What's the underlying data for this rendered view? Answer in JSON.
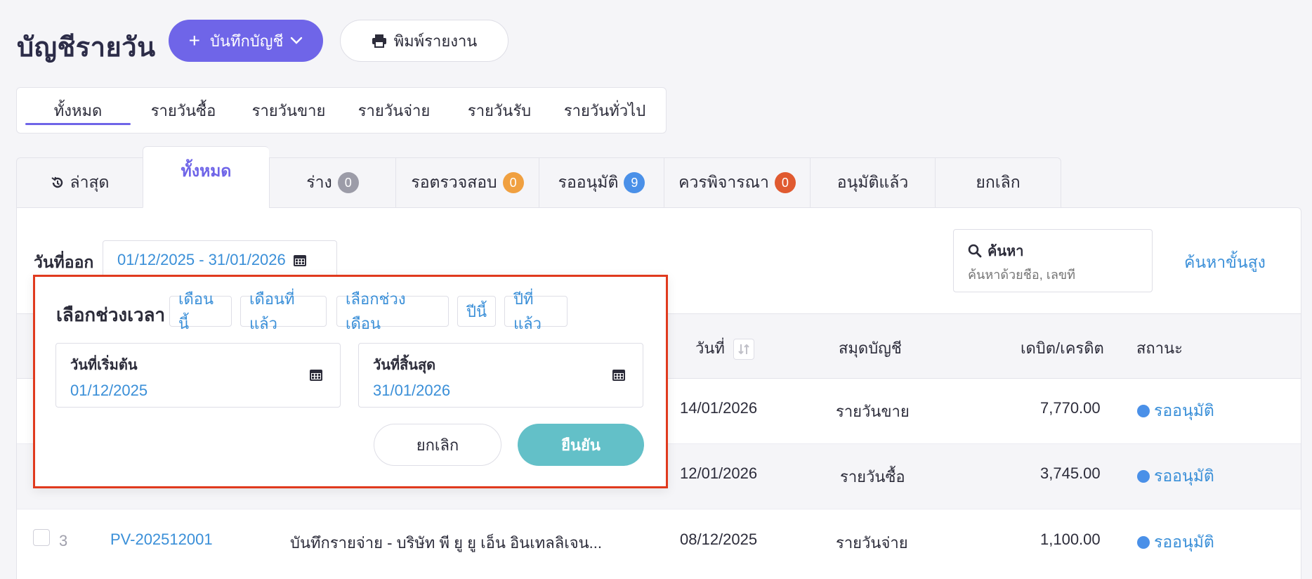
{
  "header": {
    "title": "บัญชีรายวัน",
    "record_button": "บันทึกบัญชี",
    "print_button": "พิมพ์รายงาน"
  },
  "type_tabs": [
    {
      "label": "ทั้งหมด",
      "active": true
    },
    {
      "label": "รายวันซื้อ"
    },
    {
      "label": "รายวันขาย"
    },
    {
      "label": "รายวันจ่าย"
    },
    {
      "label": "รายวันรับ"
    },
    {
      "label": "รายวันทั่วไป"
    }
  ],
  "status_tabs": [
    {
      "label": "ล่าสุด"
    },
    {
      "label": "ทั้งหมด",
      "active": true
    },
    {
      "label": "ร่าง",
      "count": "0",
      "color": "#9c9ca8"
    },
    {
      "label": "รอตรวจสอบ",
      "count": "0",
      "color": "#f0a040"
    },
    {
      "label": "รออนุมัติ",
      "count": "9",
      "color": "#4a90e8"
    },
    {
      "label": "ควรพิจารณา",
      "count": "0",
      "color": "#e05a30"
    },
    {
      "label": "อนุมัติแล้ว"
    },
    {
      "label": "ยกเลิก"
    }
  ],
  "filters": {
    "date_label": "วันที่ออก",
    "date_range": "01/12/2025 - 31/01/2026",
    "search_title": "ค้นหา",
    "search_placeholder": "ค้นหาด้วยชื่อ, เลขที่",
    "advanced_search": "ค้นหาขั้นสูง"
  },
  "table": {
    "headers": {
      "date": "วันที่",
      "book": "สมุดบัญชี",
      "amount": "เดบิต/เครดิต",
      "status": "สถานะ"
    },
    "rows": [
      {
        "date": "14/01/2026",
        "book": "รายวันขาย",
        "amount": "7,770.00",
        "status": "รออนุมัติ"
      },
      {
        "date": "12/01/2026",
        "book": "รายวันซื้อ",
        "amount": "3,745.00",
        "status": "รออนุมัติ"
      },
      {
        "index": "3",
        "doc_no": "PV-202512001",
        "description": "บันทึกรายจ่าย - บริษัท พี ยู ยู เอ็น อินเทลลิเจน...",
        "date": "08/12/2025",
        "book": "รายวันจ่าย",
        "amount": "1,100.00",
        "status": "รออนุมัติ"
      }
    ]
  },
  "popup": {
    "title": "เลือกช่วงเวลา",
    "presets": [
      "เดือนนี้",
      "เดือนที่แล้ว",
      "เลือกช่วงเดือน",
      "ปีนี้",
      "ปีที่แล้ว"
    ],
    "start_label": "วันที่เริ่มต้น",
    "start_value": "01/12/2025",
    "end_label": "วันที่สิ้นสุด",
    "end_value": "31/01/2026",
    "cancel": "ยกเลิก",
    "confirm": "ยืนยัน"
  },
  "colors": {
    "primary": "#6f65e8",
    "link": "#3a8fd8",
    "confirm": "#63c0c8",
    "highlight": "#e03a1e"
  }
}
